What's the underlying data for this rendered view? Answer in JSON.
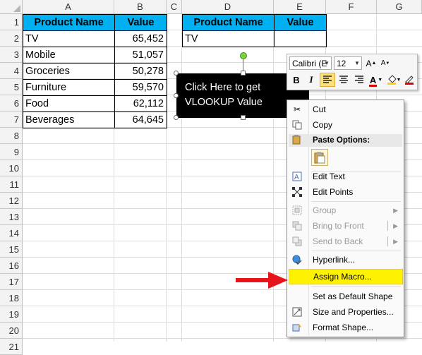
{
  "sheet": {
    "columns": [
      "A",
      "B",
      "C",
      "D",
      "E",
      "F",
      "G"
    ],
    "rows": [
      "1",
      "2",
      "3",
      "4",
      "5",
      "6",
      "7",
      "8",
      "9",
      "10",
      "11",
      "12",
      "13",
      "14",
      "15",
      "16",
      "17",
      "18",
      "19",
      "20",
      "21"
    ]
  },
  "table1": {
    "headers": [
      "Product Name",
      "Value"
    ],
    "rows": [
      [
        "TV",
        "65,452"
      ],
      [
        "Mobile",
        "51,057"
      ],
      [
        "Groceries",
        "50,278"
      ],
      [
        "Furniture",
        "59,570"
      ],
      [
        "Food",
        "62,112"
      ],
      [
        "Beverages",
        "64,645"
      ]
    ],
    "header_color": "#00b0f0"
  },
  "table2": {
    "headers": [
      "Product Name",
      "Value"
    ],
    "row": [
      "TV",
      ""
    ]
  },
  "shape": {
    "text_line1": "Click Here  to get",
    "text_line2": "VLOOKUP Value",
    "fill": "#000000"
  },
  "mini_toolbar": {
    "font_name": "Calibri (E",
    "font_size": "12",
    "bold_label": "B",
    "italic_label": "I",
    "font_color_label": "A",
    "icons": [
      "bold-icon",
      "italic-icon",
      "align-left-icon",
      "align-center-icon",
      "align-right-icon",
      "font-color-icon",
      "fill-color-icon",
      "outline-color-icon"
    ]
  },
  "context_menu": {
    "cut": "Cut",
    "copy": "Copy",
    "paste_options": "Paste Options:",
    "edit_text": "Edit Text",
    "edit_points": "Edit Points",
    "group": "Group",
    "bring_to_front": "Bring to Front",
    "send_to_back": "Send to Back",
    "hyperlink": "Hyperlink...",
    "assign_macro": "Assign Macro...",
    "set_default": "Set as Default Shape",
    "size_properties": "Size and Properties...",
    "format_shape": "Format Shape...",
    "highlight_color": "#fff200"
  },
  "annotation": {
    "arrow_color": "#e8141b"
  }
}
